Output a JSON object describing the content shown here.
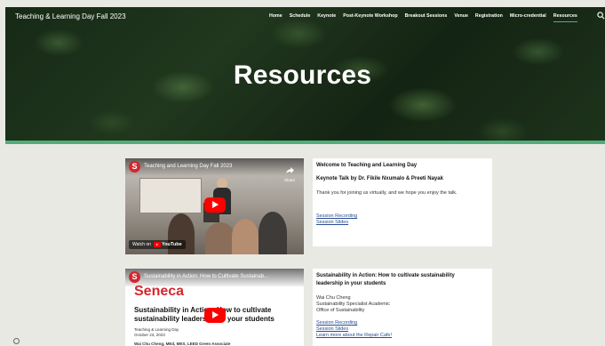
{
  "site": {
    "title": "Teaching & Learning Day Fall 2023"
  },
  "nav": {
    "items": [
      {
        "label": "Home"
      },
      {
        "label": "Schedule"
      },
      {
        "label": "Keynote"
      },
      {
        "label": "Post-Keynote Workshop"
      },
      {
        "label": "Breakout Sessions"
      },
      {
        "label": "Venue"
      },
      {
        "label": "Registration"
      },
      {
        "label": "Micro-credential"
      },
      {
        "label": "Resources",
        "active": true
      }
    ],
    "more_icon": "search-icon"
  },
  "hero": {
    "title": "Resources"
  },
  "videos": [
    {
      "channel_logo_letter": "S",
      "title": "Teaching and Learning Day Fall 2023",
      "share_label": "Share",
      "watch_on": "Watch on",
      "youtube_word": "YouTube"
    },
    {
      "channel_logo_letter": "S",
      "title": "Sustainability in Action: How to Cultivate Sustainab...",
      "brand": "Seneca",
      "slide_line1": "Sustainability in Action: How to cultivate",
      "slide_line2": "sustainability leadership in your students",
      "slide_small1": "Teaching & Learning Day",
      "slide_small2": "October 23, 2023",
      "slide_small3": "Wai Chu Cheng, MEd, MES, LEED Green Associate"
    }
  ],
  "cards": [
    {
      "heading": "Welcome to Teaching and Learning Day",
      "subheading": "Keynote Talk by Dr. Fikile Nxumalo & Preeti Nayak",
      "text": "Thank you for joining us virtually, and we hope you enjoy the talk.",
      "links": [
        "Session Recording",
        "Session Slides"
      ]
    },
    {
      "heading_line1": "Sustainability in Action: How to cultivate sustainability",
      "heading_line2": "leadership in your students",
      "presenter": "Wai Chu Cheng",
      "role": "Sustainability Specialist Academic",
      "office": "Office of Sustainability",
      "links": [
        "Session Recording",
        "Session Slides",
        "Learn more about the Repair Cafe!"
      ]
    }
  ],
  "colors": {
    "accent": "#4fae7a",
    "brand_red": "#d4272e",
    "link": "#2a4d8f"
  }
}
